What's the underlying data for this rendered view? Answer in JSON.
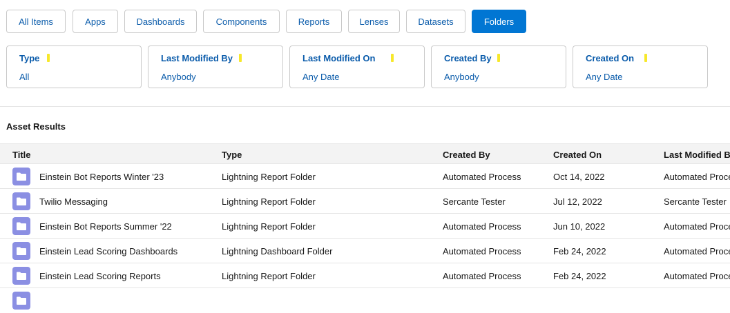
{
  "tabs": [
    {
      "label": "All Items",
      "active": false
    },
    {
      "label": "Apps",
      "active": false
    },
    {
      "label": "Dashboards",
      "active": false
    },
    {
      "label": "Components",
      "active": false
    },
    {
      "label": "Reports",
      "active": false
    },
    {
      "label": "Lenses",
      "active": false
    },
    {
      "label": "Datasets",
      "active": false
    },
    {
      "label": "Folders",
      "active": true
    }
  ],
  "filters": [
    {
      "label": "Type",
      "value": "All"
    },
    {
      "label": "Last Modified By",
      "value": "Anybody"
    },
    {
      "label": "Last Modified On",
      "value": "Any Date"
    },
    {
      "label": "Created By",
      "value": "Anybody"
    },
    {
      "label": "Created On",
      "value": "Any Date"
    }
  ],
  "results_title": "Asset Results",
  "columns": [
    "Title",
    "Type",
    "Created By",
    "Created On",
    "Last Modified By"
  ],
  "rows": [
    {
      "title": "Einstein Bot Reports Winter '23",
      "type": "Lightning Report Folder",
      "created_by": "Automated Process",
      "created_on": "Oct 14, 2022",
      "last_modified": "Automated Process"
    },
    {
      "title": "Twilio Messaging",
      "type": "Lightning Report Folder",
      "created_by": "Sercante Tester",
      "created_on": "Jul 12, 2022",
      "last_modified": "Sercante Tester"
    },
    {
      "title": "Einstein Bot Reports Summer '22",
      "type": "Lightning Report Folder",
      "created_by": "Automated Process",
      "created_on": "Jun 10, 2022",
      "last_modified": "Automated Process"
    },
    {
      "title": "Einstein Lead Scoring Dashboards",
      "type": "Lightning Dashboard Folder",
      "created_by": "Automated Process",
      "created_on": "Feb 24, 2022",
      "last_modified": "Automated Process"
    },
    {
      "title": "Einstein Lead Scoring Reports",
      "type": "Lightning Report Folder",
      "created_by": "Automated Process",
      "created_on": "Feb 24, 2022",
      "last_modified": "Automated Process"
    },
    {
      "title": "",
      "type": "",
      "created_by": "",
      "created_on": "",
      "last_modified": ""
    }
  ],
  "icons": {
    "folder": "folder-icon",
    "filter_marker": "marker-icon"
  },
  "colors": {
    "accent": "#0176d3",
    "link": "#0b5cab",
    "folder_icon": "#8b8fe3",
    "marker": "#f7e82b"
  }
}
